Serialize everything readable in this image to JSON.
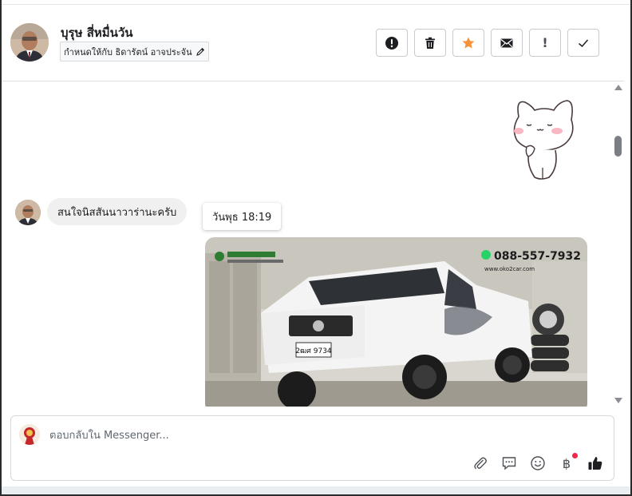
{
  "header": {
    "contact_name": "บุรุษ สี่หมื่นวัน",
    "assign_label": "กำหนดให้กับ ธิดารัตน์ อาจประจัน",
    "toolbar": [
      {
        "name": "spam-button",
        "icon": "exclamation-circle-icon"
      },
      {
        "name": "delete-button",
        "icon": "trash-icon"
      },
      {
        "name": "star-button",
        "icon": "star-icon"
      },
      {
        "name": "mail-button",
        "icon": "envelope-icon"
      },
      {
        "name": "follow-up-button",
        "icon": "exclamation-icon",
        "glyph": "!"
      },
      {
        "name": "done-button",
        "icon": "checkmark-icon"
      }
    ]
  },
  "messages": {
    "sticker_icon": "cat-sticker-icon",
    "incoming_text": "สนใจนิสสันนาวาร่านะครับ",
    "timestamp_tooltip": "วันพุธ 18:19",
    "photo": {
      "icon": "pickup-truck-photo",
      "phone": "088-557-7932",
      "website": "www.oko2car.com",
      "plate": "2ฒศ 9734"
    }
  },
  "composer": {
    "placeholder": "ตอบกลับใน Messenger...",
    "icons": [
      "paperclip-icon",
      "saved-reply-icon",
      "emoji-icon",
      "baht-payment-icon",
      "thumbs-up-icon"
    ],
    "baht_glyph": "฿"
  },
  "colors": {
    "accent_star": "#f7923a",
    "notification_dot": "#f02849",
    "bubble_bg": "#f0f0f0"
  }
}
